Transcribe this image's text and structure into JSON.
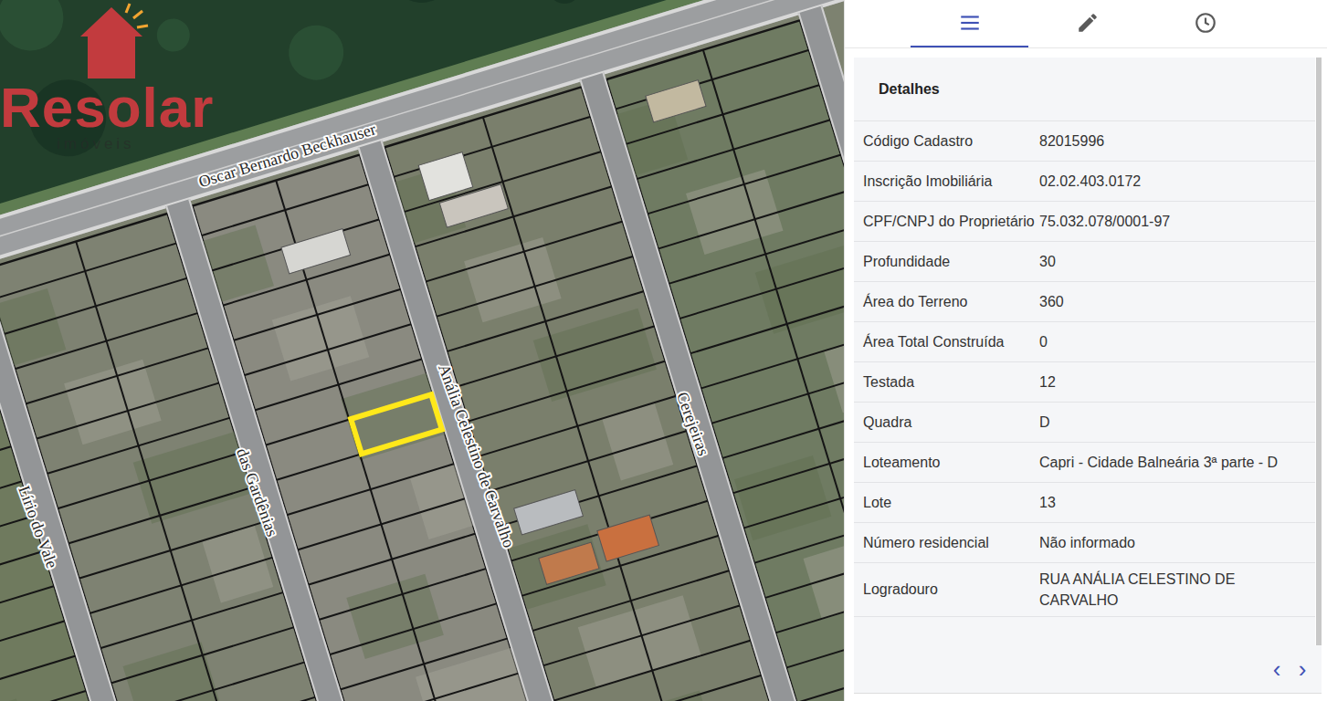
{
  "logo": {
    "name": "Resolar",
    "tagline": "imóveis"
  },
  "map": {
    "streets": [
      {
        "name": "Oscar Bernardo Beckhauser"
      },
      {
        "name": "das Gardênias"
      },
      {
        "name": "Anália Celestino de Carvalho"
      },
      {
        "name": "Cerejeiras"
      },
      {
        "name": "Lírio do Vale"
      }
    ],
    "lot": {
      "selected": true
    }
  },
  "tabs": [
    {
      "kind": "list",
      "selected": true
    },
    {
      "kind": "edit",
      "selected": false
    },
    {
      "kind": "history",
      "selected": false
    }
  ],
  "panel": {
    "title": "Detalhes",
    "rows": [
      {
        "label": "Código Cadastro",
        "value": "82015996"
      },
      {
        "label": "Inscrição Imobiliária",
        "value": "02.02.403.0172"
      },
      {
        "label": "CPF/CNPJ do Proprietário",
        "value": "75.032.078/0001-97"
      },
      {
        "label": "Profundidade",
        "value": "30"
      },
      {
        "label": "Área do Terreno",
        "value": "360"
      },
      {
        "label": "Área Total Construída",
        "value": "0"
      },
      {
        "label": "Testada",
        "value": "12"
      },
      {
        "label": "Quadra",
        "value": "D"
      },
      {
        "label": "Loteamento",
        "value": "Capri - Cidade Balneária 3ª parte - D"
      },
      {
        "label": "Lote",
        "value": "13"
      },
      {
        "label": "Número residencial",
        "value": "Não informado"
      },
      {
        "label": "Logradouro",
        "value": "RUA ANÁLIA CELESTINO DE CARVALHO"
      }
    ]
  },
  "pager": {
    "prev": "‹",
    "next": "›"
  }
}
